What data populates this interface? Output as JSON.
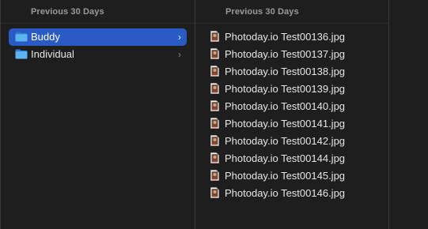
{
  "columns": [
    {
      "header": "Previous 30 Days",
      "items": [
        {
          "label": "Buddy",
          "icon": "folder-icon",
          "selected": true
        },
        {
          "label": "Individual",
          "icon": "folder-icon",
          "selected": false
        }
      ]
    },
    {
      "header": "Previous 30 Days",
      "items": [
        {
          "label": "Photoday.io Test00136.jpg",
          "icon": "jpg-file-icon"
        },
        {
          "label": "Photoday.io Test00137.jpg",
          "icon": "jpg-file-icon"
        },
        {
          "label": "Photoday.io Test00138.jpg",
          "icon": "jpg-file-icon"
        },
        {
          "label": "Photoday.io Test00139.jpg",
          "icon": "jpg-file-icon"
        },
        {
          "label": "Photoday.io Test00140.jpg",
          "icon": "jpg-file-icon"
        },
        {
          "label": "Photoday.io Test00141.jpg",
          "icon": "jpg-file-icon"
        },
        {
          "label": "Photoday.io Test00142.jpg",
          "icon": "jpg-file-icon"
        },
        {
          "label": "Photoday.io Test00144.jpg",
          "icon": "jpg-file-icon"
        },
        {
          "label": "Photoday.io Test00145.jpg",
          "icon": "jpg-file-icon"
        },
        {
          "label": "Photoday.io Test00146.jpg",
          "icon": "jpg-file-icon"
        }
      ]
    }
  ],
  "colors": {
    "background": "#1e1e1e",
    "selection": "#2a5bc4",
    "folder": "#4aa6ec",
    "text": "#e6e6e6",
    "header_text": "#9a9a9a"
  }
}
